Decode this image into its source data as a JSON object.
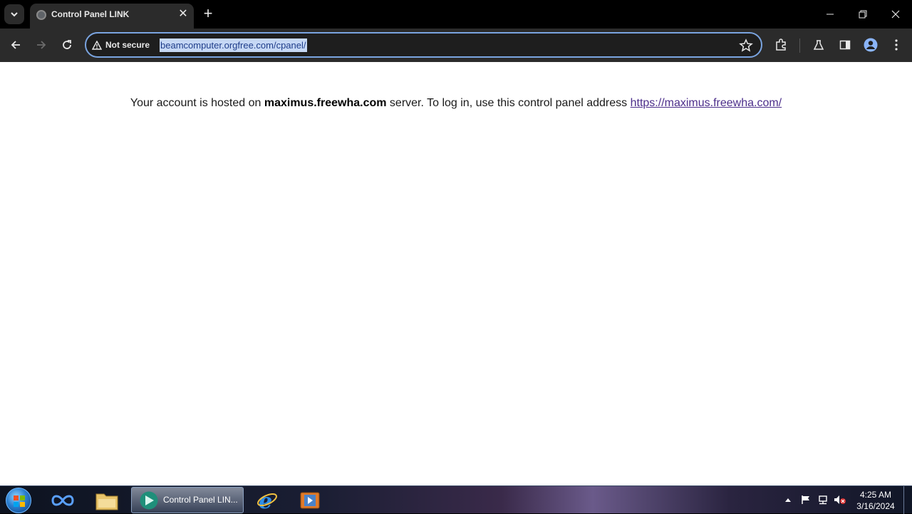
{
  "browser": {
    "tab_title": "Control Panel LINK",
    "url": "beamcomputer.orgfree.com/cpanel/",
    "security_label": "Not secure"
  },
  "page": {
    "text_before": "Your account is hosted on ",
    "server_name": "maximus.freewha.com",
    "text_middle": " server. To log in, use this control panel address ",
    "link": "https://maximus.freewha.com/"
  },
  "taskbar": {
    "active_window_label": "Control Panel LIN...",
    "time": "4:25 AM",
    "date": "3/16/2024"
  },
  "colors": {
    "link": "#4b2d8a",
    "omnibox_focus": "#7aa4e0",
    "url_selection": "#c6d8f5"
  }
}
